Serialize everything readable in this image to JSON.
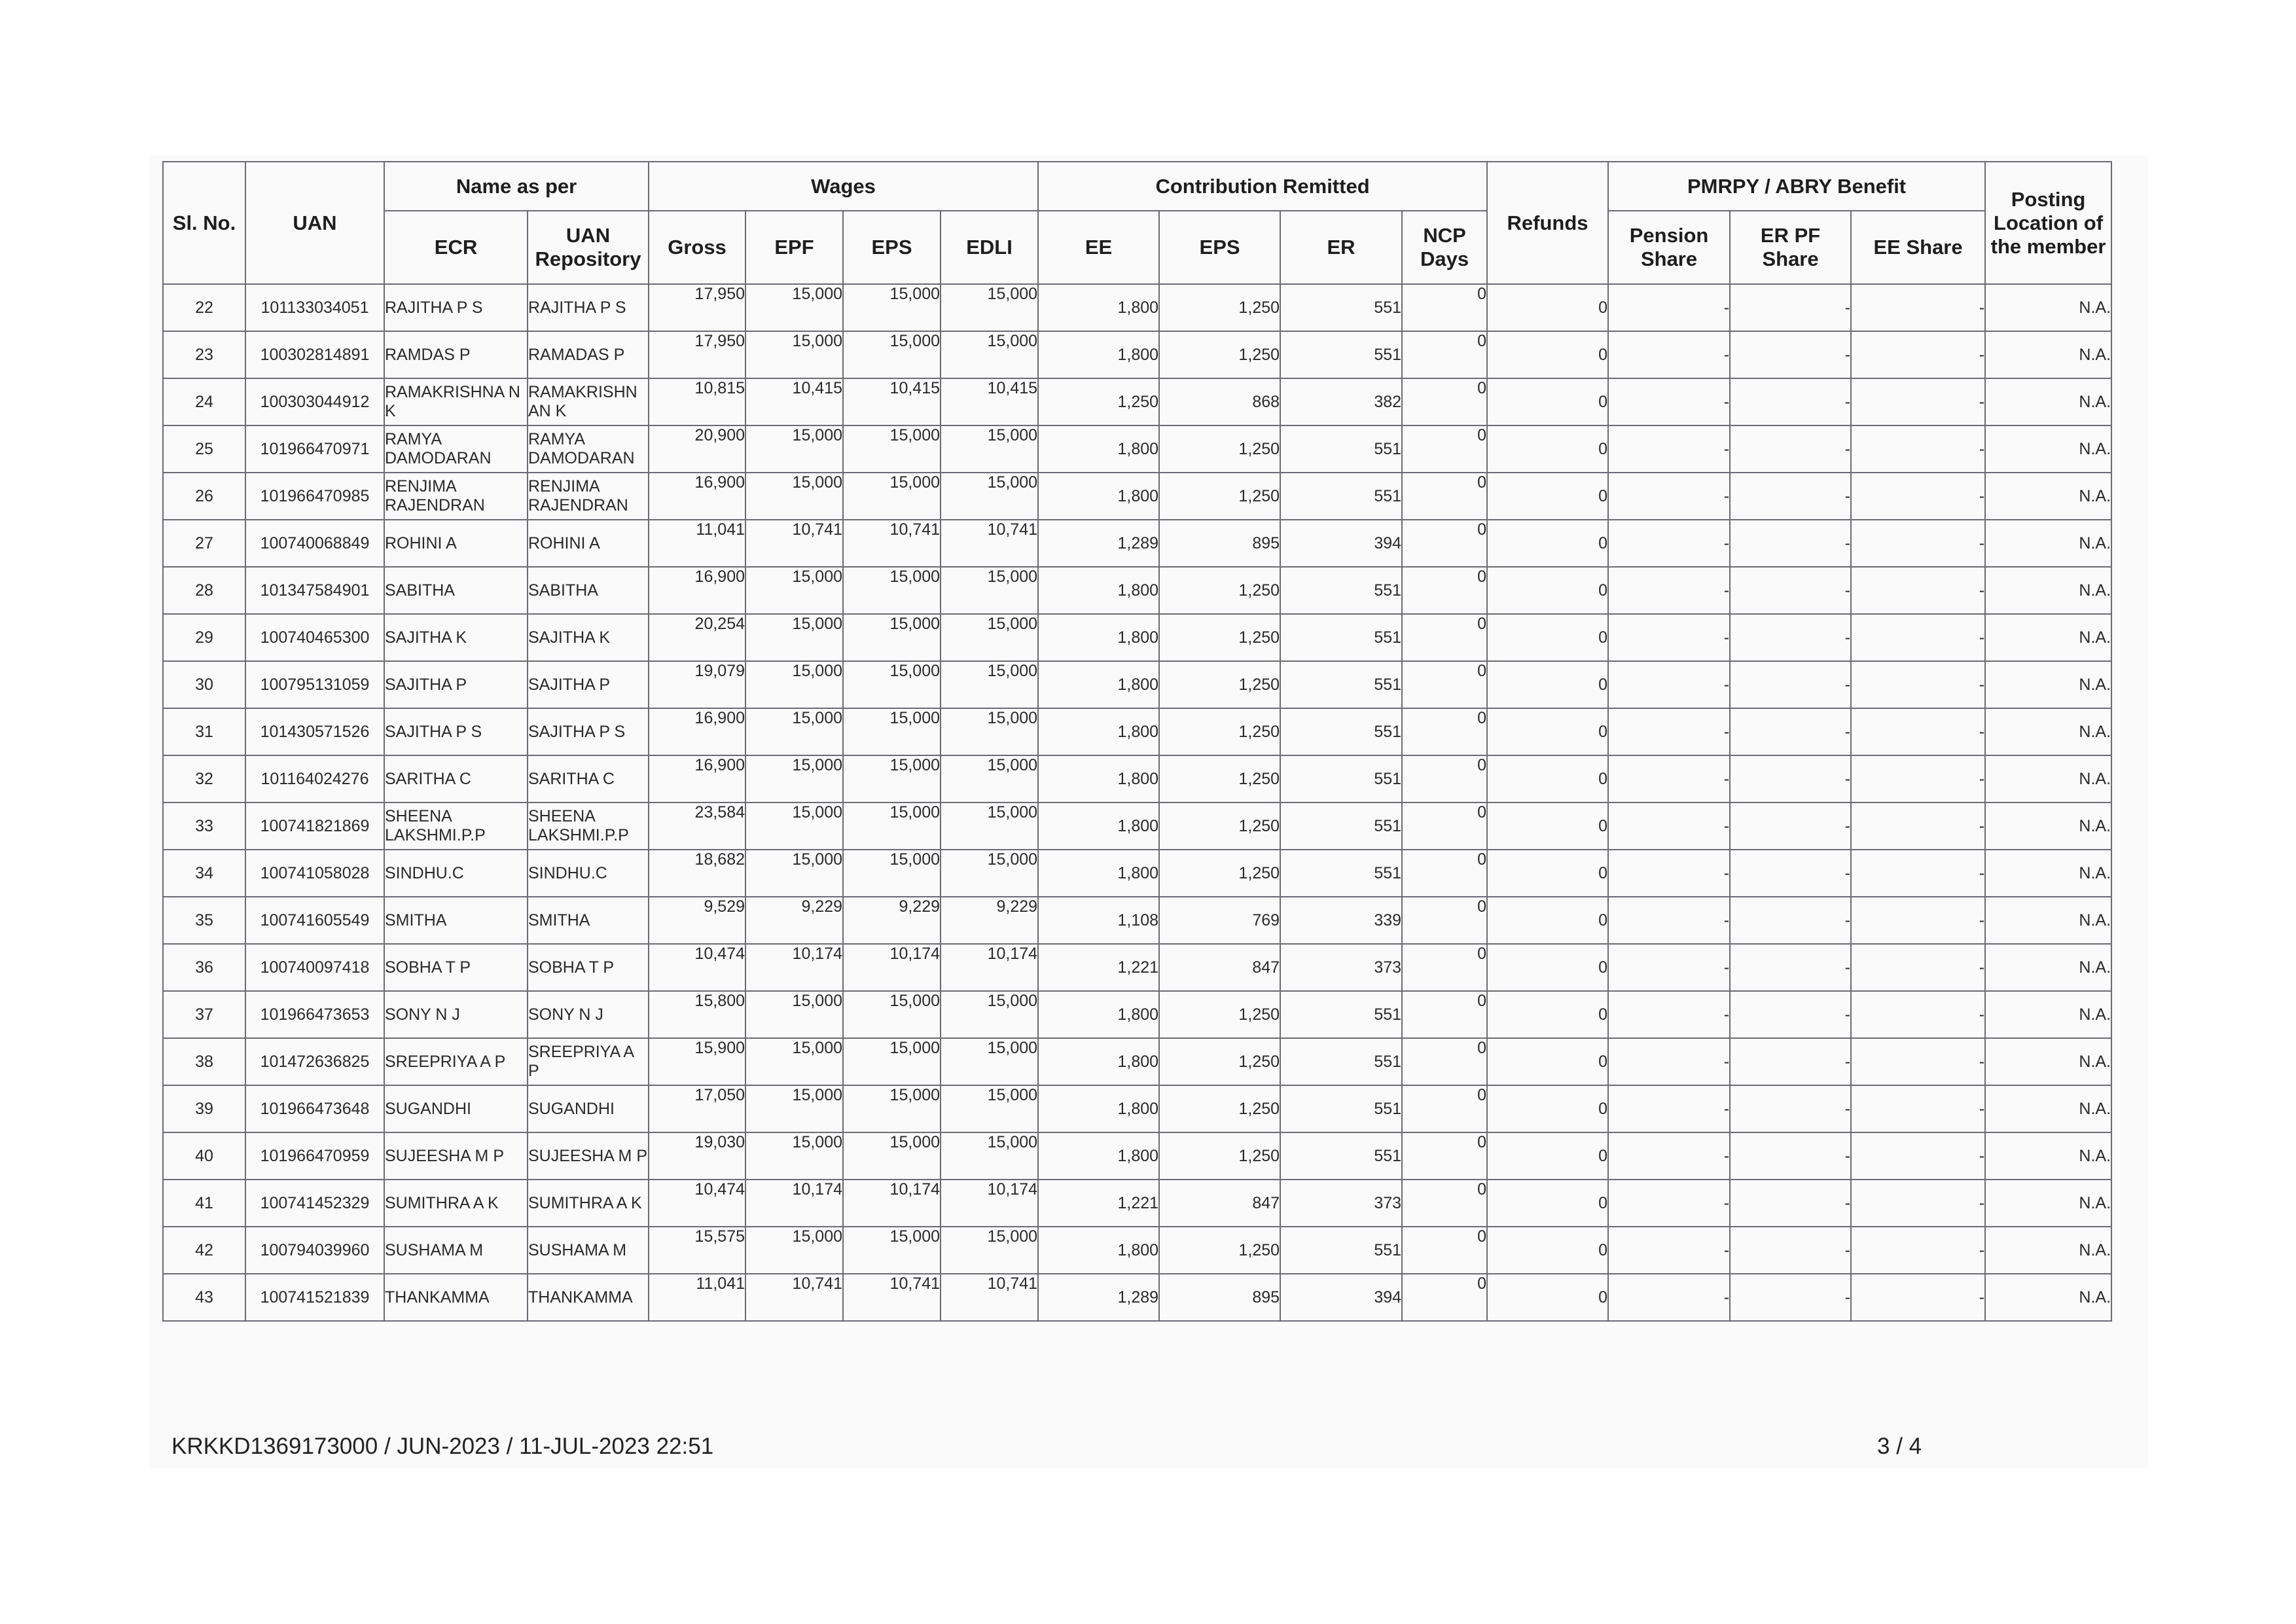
{
  "table": {
    "headers": {
      "sl_no": "Sl. No.",
      "uan": "UAN",
      "name_group": "Name as per",
      "ecr": "ECR",
      "uan_repository": "UAN Repository",
      "wages_group": "Wages",
      "gross": "Gross",
      "epf": "EPF",
      "eps": "EPS",
      "edli": "EDLI",
      "contribution_group": "Contribution Remitted",
      "ee": "EE",
      "c_eps": "EPS",
      "er": "ER",
      "ncp_days": "NCP Days",
      "refunds": "Refunds",
      "benefit_group": "PMRPY / ABRY Benefit",
      "pension_share": "Pension Share",
      "er_pf_share": "ER PF Share",
      "ee_share": "EE Share",
      "posting_location": "Posting Location of the member"
    },
    "rows": [
      {
        "sl": "22",
        "uan": "101133034051",
        "ecr": "RAJITHA P S",
        "repo": "RAJITHA P S",
        "gross": "17,950",
        "epf": "15,000",
        "eps": "15,000",
        "edli": "15,000",
        "ee": "1,800",
        "ceps": "1,250",
        "er": "551",
        "ncp": "0",
        "refunds": "0",
        "pension": "-",
        "erpf": "-",
        "eeshare": "-",
        "posting": "N.A."
      },
      {
        "sl": "23",
        "uan": "100302814891",
        "ecr": "RAMDAS P",
        "repo": "RAMADAS P",
        "gross": "17,950",
        "epf": "15,000",
        "eps": "15,000",
        "edli": "15,000",
        "ee": "1,800",
        "ceps": "1,250",
        "er": "551",
        "ncp": "0",
        "refunds": "0",
        "pension": "-",
        "erpf": "-",
        "eeshare": "-",
        "posting": "N.A."
      },
      {
        "sl": "24",
        "uan": "100303044912",
        "ecr": "RAMAKRISHNA N K",
        "repo": "RAMAKRISHN AN K",
        "gross": "10,815",
        "epf": "10,415",
        "eps": "10,415",
        "edli": "10,415",
        "ee": "1,250",
        "ceps": "868",
        "er": "382",
        "ncp": "0",
        "refunds": "0",
        "pension": "-",
        "erpf": "-",
        "eeshare": "-",
        "posting": "N.A."
      },
      {
        "sl": "25",
        "uan": "101966470971",
        "ecr": "RAMYA DAMODARAN",
        "repo": "RAMYA DAMODARAN",
        "gross": "20,900",
        "epf": "15,000",
        "eps": "15,000",
        "edli": "15,000",
        "ee": "1,800",
        "ceps": "1,250",
        "er": "551",
        "ncp": "0",
        "refunds": "0",
        "pension": "-",
        "erpf": "-",
        "eeshare": "-",
        "posting": "N.A."
      },
      {
        "sl": "26",
        "uan": "101966470985",
        "ecr": "RENJIMA RAJENDRAN",
        "repo": "RENJIMA RAJENDRAN",
        "gross": "16,900",
        "epf": "15,000",
        "eps": "15,000",
        "edli": "15,000",
        "ee": "1,800",
        "ceps": "1,250",
        "er": "551",
        "ncp": "0",
        "refunds": "0",
        "pension": "-",
        "erpf": "-",
        "eeshare": "-",
        "posting": "N.A."
      },
      {
        "sl": "27",
        "uan": "100740068849",
        "ecr": "ROHINI A",
        "repo": "ROHINI A",
        "gross": "11,041",
        "epf": "10,741",
        "eps": "10,741",
        "edli": "10,741",
        "ee": "1,289",
        "ceps": "895",
        "er": "394",
        "ncp": "0",
        "refunds": "0",
        "pension": "-",
        "erpf": "-",
        "eeshare": "-",
        "posting": "N.A."
      },
      {
        "sl": "28",
        "uan": "101347584901",
        "ecr": "SABITHA",
        "repo": "SABITHA",
        "gross": "16,900",
        "epf": "15,000",
        "eps": "15,000",
        "edli": "15,000",
        "ee": "1,800",
        "ceps": "1,250",
        "er": "551",
        "ncp": "0",
        "refunds": "0",
        "pension": "-",
        "erpf": "-",
        "eeshare": "-",
        "posting": "N.A."
      },
      {
        "sl": "29",
        "uan": "100740465300",
        "ecr": "SAJITHA K",
        "repo": "SAJITHA K",
        "gross": "20,254",
        "epf": "15,000",
        "eps": "15,000",
        "edli": "15,000",
        "ee": "1,800",
        "ceps": "1,250",
        "er": "551",
        "ncp": "0",
        "refunds": "0",
        "pension": "-",
        "erpf": "-",
        "eeshare": "-",
        "posting": "N.A."
      },
      {
        "sl": "30",
        "uan": "100795131059",
        "ecr": "SAJITHA P",
        "repo": "SAJITHA P",
        "gross": "19,079",
        "epf": "15,000",
        "eps": "15,000",
        "edli": "15,000",
        "ee": "1,800",
        "ceps": "1,250",
        "er": "551",
        "ncp": "0",
        "refunds": "0",
        "pension": "-",
        "erpf": "-",
        "eeshare": "-",
        "posting": "N.A."
      },
      {
        "sl": "31",
        "uan": "101430571526",
        "ecr": "SAJITHA P S",
        "repo": "SAJITHA P S",
        "gross": "16,900",
        "epf": "15,000",
        "eps": "15,000",
        "edli": "15,000",
        "ee": "1,800",
        "ceps": "1,250",
        "er": "551",
        "ncp": "0",
        "refunds": "0",
        "pension": "-",
        "erpf": "-",
        "eeshare": "-",
        "posting": "N.A."
      },
      {
        "sl": "32",
        "uan": "101164024276",
        "ecr": "SARITHA C",
        "repo": "SARITHA C",
        "gross": "16,900",
        "epf": "15,000",
        "eps": "15,000",
        "edli": "15,000",
        "ee": "1,800",
        "ceps": "1,250",
        "er": "551",
        "ncp": "0",
        "refunds": "0",
        "pension": "-",
        "erpf": "-",
        "eeshare": "-",
        "posting": "N.A."
      },
      {
        "sl": "33",
        "uan": "100741821869",
        "ecr": "SHEENA LAKSHMI.P.P",
        "repo": "SHEENA LAKSHMI.P.P",
        "gross": "23,584",
        "epf": "15,000",
        "eps": "15,000",
        "edli": "15,000",
        "ee": "1,800",
        "ceps": "1,250",
        "er": "551",
        "ncp": "0",
        "refunds": "0",
        "pension": "-",
        "erpf": "-",
        "eeshare": "-",
        "posting": "N.A."
      },
      {
        "sl": "34",
        "uan": "100741058028",
        "ecr": "SINDHU.C",
        "repo": "SINDHU.C",
        "gross": "18,682",
        "epf": "15,000",
        "eps": "15,000",
        "edli": "15,000",
        "ee": "1,800",
        "ceps": "1,250",
        "er": "551",
        "ncp": "0",
        "refunds": "0",
        "pension": "-",
        "erpf": "-",
        "eeshare": "-",
        "posting": "N.A."
      },
      {
        "sl": "35",
        "uan": "100741605549",
        "ecr": "SMITHA",
        "repo": "SMITHA",
        "gross": "9,529",
        "epf": "9,229",
        "eps": "9,229",
        "edli": "9,229",
        "ee": "1,108",
        "ceps": "769",
        "er": "339",
        "ncp": "0",
        "refunds": "0",
        "pension": "-",
        "erpf": "-",
        "eeshare": "-",
        "posting": "N.A."
      },
      {
        "sl": "36",
        "uan": "100740097418",
        "ecr": "SOBHA T P",
        "repo": "SOBHA T P",
        "gross": "10,474",
        "epf": "10,174",
        "eps": "10,174",
        "edli": "10,174",
        "ee": "1,221",
        "ceps": "847",
        "er": "373",
        "ncp": "0",
        "refunds": "0",
        "pension": "-",
        "erpf": "-",
        "eeshare": "-",
        "posting": "N.A."
      },
      {
        "sl": "37",
        "uan": "101966473653",
        "ecr": "SONY N J",
        "repo": "SONY N J",
        "gross": "15,800",
        "epf": "15,000",
        "eps": "15,000",
        "edli": "15,000",
        "ee": "1,800",
        "ceps": "1,250",
        "er": "551",
        "ncp": "0",
        "refunds": "0",
        "pension": "-",
        "erpf": "-",
        "eeshare": "-",
        "posting": "N.A."
      },
      {
        "sl": "38",
        "uan": "101472636825",
        "ecr": "SREEPRIYA A P",
        "repo": "SREEPRIYA A P",
        "gross": "15,900",
        "epf": "15,000",
        "eps": "15,000",
        "edli": "15,000",
        "ee": "1,800",
        "ceps": "1,250",
        "er": "551",
        "ncp": "0",
        "refunds": "0",
        "pension": "-",
        "erpf": "-",
        "eeshare": "-",
        "posting": "N.A."
      },
      {
        "sl": "39",
        "uan": "101966473648",
        "ecr": "SUGANDHI",
        "repo": "SUGANDHI",
        "gross": "17,050",
        "epf": "15,000",
        "eps": "15,000",
        "edli": "15,000",
        "ee": "1,800",
        "ceps": "1,250",
        "er": "551",
        "ncp": "0",
        "refunds": "0",
        "pension": "-",
        "erpf": "-",
        "eeshare": "-",
        "posting": "N.A."
      },
      {
        "sl": "40",
        "uan": "101966470959",
        "ecr": "SUJEESHA M P",
        "repo": "SUJEESHA M P",
        "gross": "19,030",
        "epf": "15,000",
        "eps": "15,000",
        "edli": "15,000",
        "ee": "1,800",
        "ceps": "1,250",
        "er": "551",
        "ncp": "0",
        "refunds": "0",
        "pension": "-",
        "erpf": "-",
        "eeshare": "-",
        "posting": "N.A."
      },
      {
        "sl": "41",
        "uan": "100741452329",
        "ecr": "SUMITHRA A K",
        "repo": "SUMITHRA A K",
        "gross": "10,474",
        "epf": "10,174",
        "eps": "10,174",
        "edli": "10,174",
        "ee": "1,221",
        "ceps": "847",
        "er": "373",
        "ncp": "0",
        "refunds": "0",
        "pension": "-",
        "erpf": "-",
        "eeshare": "-",
        "posting": "N.A."
      },
      {
        "sl": "42",
        "uan": "100794039960",
        "ecr": "SUSHAMA M",
        "repo": "SUSHAMA M",
        "gross": "15,575",
        "epf": "15,000",
        "eps": "15,000",
        "edli": "15,000",
        "ee": "1,800",
        "ceps": "1,250",
        "er": "551",
        "ncp": "0",
        "refunds": "0",
        "pension": "-",
        "erpf": "-",
        "eeshare": "-",
        "posting": "N.A."
      },
      {
        "sl": "43",
        "uan": "100741521839",
        "ecr": "THANKAMMA",
        "repo": "THANKAMMA",
        "gross": "11,041",
        "epf": "10,741",
        "eps": "10,741",
        "edli": "10,741",
        "ee": "1,289",
        "ceps": "895",
        "er": "394",
        "ncp": "0",
        "refunds": "0",
        "pension": "-",
        "erpf": "-",
        "eeshare": "-",
        "posting": "N.A."
      }
    ]
  },
  "footer": {
    "reference": "KRKKD1369173000 / JUN-2023 / 11-JUL-2023 22:51",
    "page": "3 / 4"
  }
}
